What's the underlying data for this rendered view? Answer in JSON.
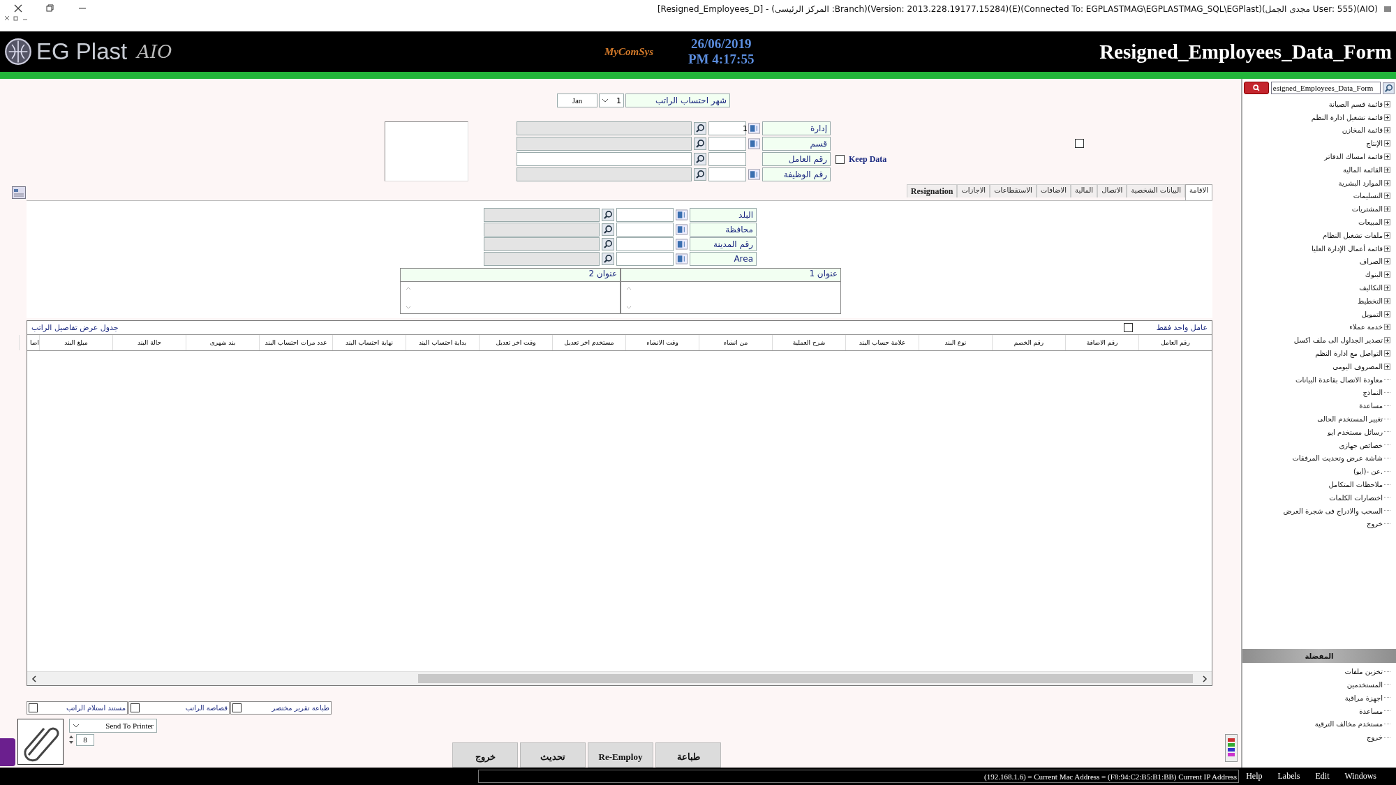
{
  "title_bar": {
    "title": "[Resigned_Employees_D] - (المركز الرئيسى :Branch)(Version: 2013.228.19177.15284)(E)(Connected To: EGPLASTMAG\\EGPLASTMAG_SQL\\EGPlast)(مجدى الجمل User: 555)(AIO)"
  },
  "header": {
    "brand": "EG Plast",
    "brand_mark": "AIO",
    "vendor": "MyComSys",
    "date": "26/06/2019",
    "time": "PM 4:17:55",
    "form_title": "Resigned_Employees_Data_Form"
  },
  "salary_month": {
    "label": "شهر احتساب الراتب",
    "value": "1",
    "month": "Jan"
  },
  "form_checkbox": {
    "checked": false
  },
  "lookups": [
    {
      "label": "إدارة",
      "code": "1",
      "picker": true,
      "disabled": true
    },
    {
      "label": "قسم",
      "picker": true,
      "disabled": true
    },
    {
      "label": "رقم العامل",
      "picker": false,
      "disabled": false
    },
    {
      "label": "رقم الوظيفة",
      "picker": true,
      "disabled": true
    }
  ],
  "keep_data": {
    "label": "Keep Data",
    "checked": false
  },
  "tabs": [
    {
      "label": "الاقامة",
      "selected": true
    },
    {
      "label": "البيانات الشخصية",
      "selected": false
    },
    {
      "label": "الاتصال",
      "selected": false
    },
    {
      "label": "المالية",
      "selected": false
    },
    {
      "label": "الاضافات",
      "selected": false
    },
    {
      "label": "الاستقطاعات",
      "selected": false
    },
    {
      "label": "الاجازات",
      "selected": false
    },
    {
      "label": "Resignation",
      "selected": false
    }
  ],
  "address_fields": [
    {
      "label": "البلد"
    },
    {
      "label": "محافظة"
    },
    {
      "label": "رقم المدينة"
    },
    {
      "label": "Area"
    }
  ],
  "address_boxes": [
    {
      "label": "عنوان 1"
    },
    {
      "label": "عنوان 2"
    }
  ],
  "grid": {
    "title": "جدول عرض تفاصيل الراتب",
    "single_employee": {
      "label": "عامل واحد فقط",
      "checked": false
    },
    "columns": [
      "رقم العامل",
      "رقم الاضافة",
      "رقم الخصم",
      "نوع البند",
      "علامة حساب البند",
      "شرح العملية",
      "من انشاء",
      "وقت الانشاء",
      "مستخدم اخر تعديل",
      "وقت اخر تعديل",
      "بداية احتساب البند",
      "نهاية احتساب البند",
      "عدد مرات احتساب البند",
      "بند شهرى",
      "حالة البند",
      "مبلغ البند",
      "اضا"
    ]
  },
  "print_options": [
    {
      "label": "طباعة تقرير مختصر",
      "checked": false
    },
    {
      "label": "قصاصة الراتب",
      "checked": false
    },
    {
      "label": "مستند استلام الراتب",
      "checked": false
    }
  ],
  "printer": {
    "value": "Send To Printer",
    "copies": "8"
  },
  "buttons": [
    "طباعة",
    "Re-Employ",
    "تحديث",
    "خروج"
  ],
  "sidebar": {
    "search": "esigned_Employees_Data_Form",
    "menu": [
      {
        "label": "قائمة قسم الصيانة",
        "kind": "group"
      },
      {
        "label": "قائمة تشغيل ادارة النظم",
        "kind": "group"
      },
      {
        "label": "قائمة المخازن",
        "kind": "group"
      },
      {
        "label": "الإنتاج",
        "kind": "group"
      },
      {
        "label": "قائمة امساك الدفاتر",
        "kind": "group"
      },
      {
        "label": "القائمة المالية",
        "kind": "group"
      },
      {
        "label": "الموارد البشرية",
        "kind": "group"
      },
      {
        "label": "التسليمات",
        "kind": "group"
      },
      {
        "label": "المشتريات",
        "kind": "group"
      },
      {
        "label": "المبيعات",
        "kind": "group"
      },
      {
        "label": "ملفات تشغيل النظام",
        "kind": "group"
      },
      {
        "label": "قائمة أعمال الإدارة العليا",
        "kind": "group"
      },
      {
        "label": "الصراف",
        "kind": "group"
      },
      {
        "label": "البنوك",
        "kind": "group"
      },
      {
        "label": "التكاليف",
        "kind": "group"
      },
      {
        "label": "التخطيط",
        "kind": "group"
      },
      {
        "label": "التمويل",
        "kind": "group"
      },
      {
        "label": "خدمة عملاء",
        "kind": "group"
      },
      {
        "label": "تصدير الجداول الى ملف اكسل",
        "kind": "group"
      },
      {
        "label": "التواصل مع ادارة النظم",
        "kind": "group"
      },
      {
        "label": "المصروف اليومى",
        "kind": "group"
      },
      {
        "label": "معاودة الاتصال بقاعدة البيانات",
        "kind": "leaf"
      },
      {
        "label": "النماذج",
        "kind": "leaf"
      },
      {
        "label": "مساعدة",
        "kind": "leaf"
      },
      {
        "label": "تغيير المستخدم الحالى",
        "kind": "leaf"
      },
      {
        "label": "رسائل مستخدم ايو",
        "kind": "leaf"
      },
      {
        "label": "خصائص جهازى",
        "kind": "leaf"
      },
      {
        "label": "شاشة عرض وتحديث المرفقات",
        "kind": "leaf"
      },
      {
        "label": "عن -(ايو).",
        "kind": "leaf"
      },
      {
        "label": "ملاحظات المتكامل",
        "kind": "leaf"
      },
      {
        "label": "اختصارات الكلمات",
        "kind": "leaf"
      },
      {
        "label": "السحب والادراج فى شجرة العرض",
        "kind": "leaf"
      },
      {
        "label": "خروج",
        "kind": "leaf"
      }
    ],
    "favorites": {
      "title": "المفضلة",
      "items": [
        "تخزين ملفات",
        "المستخدمين",
        "اجهزة مراقبة",
        "مساعدة",
        "مستخدم مخالف الترقية",
        "خروج"
      ]
    }
  },
  "status_bar": {
    "text": "(192.168.1.6) = Current Mac Address = (F8:94:C2:B5:B1:BB) Current IP Address",
    "menu": [
      "Windows",
      "Edit",
      "Labels",
      "Help"
    ]
  }
}
